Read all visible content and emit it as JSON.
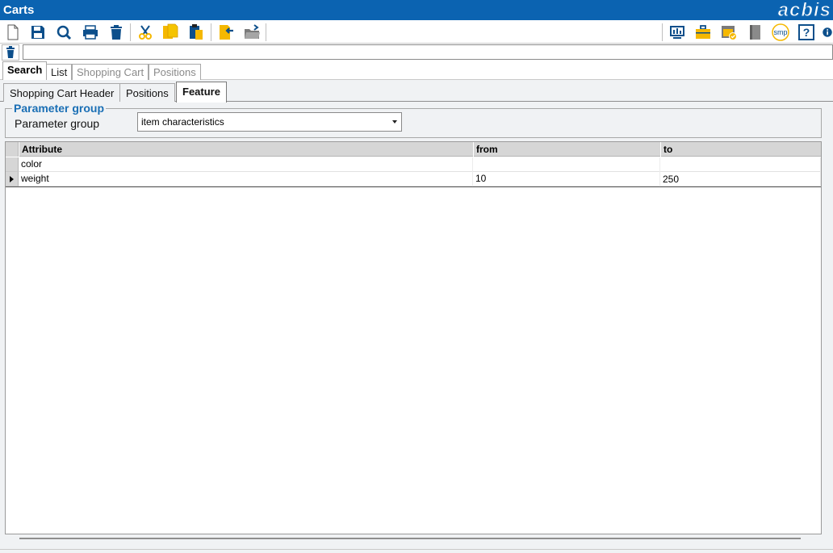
{
  "window": {
    "title": "Carts",
    "brand": "acbis"
  },
  "toolbar": {
    "left_icons": [
      "new-document-icon",
      "save-icon",
      "search-icon",
      "print-icon",
      "delete-icon",
      "cut-icon",
      "copy-icon",
      "paste-icon",
      "import-icon",
      "open-folder-icon"
    ],
    "right_icons": [
      "monitor-icon",
      "briefcase-icon",
      "folder-check-icon",
      "book-icon",
      "smp-icon",
      "help-icon",
      "info-icon"
    ],
    "smp_label": "smp",
    "help_label": "?"
  },
  "command": {
    "value": ""
  },
  "main_tabs": [
    {
      "label": "Search",
      "active": true
    },
    {
      "label": "List",
      "active": false
    },
    {
      "label": "Shopping Cart",
      "active": false
    },
    {
      "label": "Positions",
      "active": false
    }
  ],
  "sub_tabs": [
    {
      "label": "Shopping Cart Header",
      "active": false
    },
    {
      "label": "Positions",
      "active": false
    },
    {
      "label": "Feature",
      "active": true
    }
  ],
  "parameter_group": {
    "legend": "Parameter group",
    "label": "Parameter group",
    "selected": "item characteristics"
  },
  "grid": {
    "columns": [
      "Attribute",
      "from",
      "to"
    ],
    "rows": [
      {
        "attribute": "color",
        "from": "",
        "to": ""
      },
      {
        "attribute": "weight",
        "from": "10",
        "to": "250"
      }
    ],
    "selected_row": 1
  },
  "colors": {
    "title_bar": "#0b63b1",
    "accent_blue": "#1a6fb5",
    "toolbar_icon_blue": "#0d4f8b",
    "toolbar_icon_yellow": "#f5b800",
    "panel_bg": "#f0f2f4",
    "grid_header": "#d6d6d6"
  }
}
